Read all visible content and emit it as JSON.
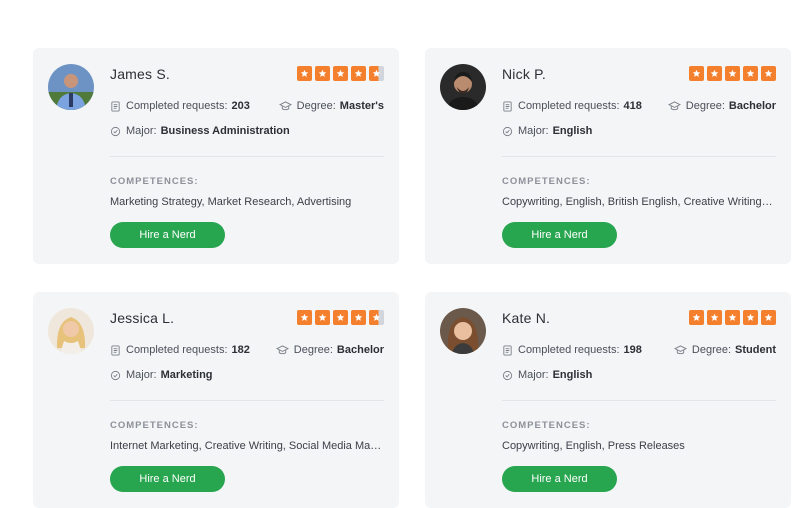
{
  "cards": [
    {
      "name": "James S.",
      "rating": 4.5,
      "requests_label": "Completed requests:",
      "requests": "203",
      "degree_label": "Degree:",
      "degree": "Master's",
      "major_label": "Major:",
      "major": "Business Administration",
      "competences_label": "COMPETENCES:",
      "competences": "Marketing Strategy, Market Research, Advertising",
      "button": "Hire a Nerd"
    },
    {
      "name": "Nick P.",
      "rating": 5,
      "requests_label": "Completed requests:",
      "requests": "418",
      "degree_label": "Degree:",
      "degree": "Bachelor",
      "major_label": "Major:",
      "major": "English",
      "competences_label": "COMPETENCES:",
      "competences": "Copywriting, English, British English, Creative Writing, W…",
      "button": "Hire a Nerd"
    },
    {
      "name": "Jessica L.",
      "rating": 4.5,
      "requests_label": "Completed requests:",
      "requests": "182",
      "degree_label": "Degree:",
      "degree": "Bachelor",
      "major_label": "Major:",
      "major": "Marketing",
      "competences_label": "COMPETENCES:",
      "competences": "Internet Marketing, Creative Writing, Social Media Mark…",
      "button": "Hire a Nerd"
    },
    {
      "name": "Kate N.",
      "rating": 5,
      "requests_label": "Completed requests:",
      "requests": "198",
      "degree_label": "Degree:",
      "degree": "Student",
      "major_label": "Major:",
      "major": "English",
      "competences_label": "COMPETENCES:",
      "competences": "Copywriting, English, Press Releases",
      "button": "Hire a Nerd"
    }
  ],
  "colors": {
    "star": "#f47f2d",
    "button": "#27a54f",
    "card_bg": "#f4f5f7"
  }
}
